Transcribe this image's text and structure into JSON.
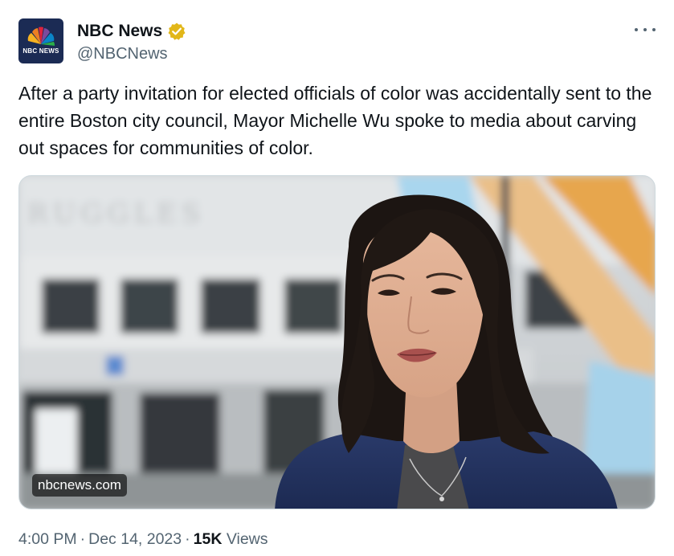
{
  "author": {
    "display_name": "NBC News",
    "handle": "@NBCNews",
    "avatar_text": "NBC NEWS",
    "verified_badge": "gold-verified-badge-icon"
  },
  "tweet": {
    "text": "After a party invitation for elected officials of color was accidentally sent to the entire Boston city council, Mayor Michelle Wu spoke to media about carving out spaces for communities of color.",
    "media_source_label": "nbcnews.com",
    "image_sign_text": "RUGGLES"
  },
  "meta": {
    "time": "4:00 PM",
    "separator": "·",
    "date": "Dec 14, 2023",
    "views_count": "15K",
    "views_label": "Views"
  },
  "icons": {
    "more": "more-options-icon",
    "logo": "nbc-peacock-icon"
  },
  "colors": {
    "text_primary": "#0f1419",
    "text_secondary": "#536471",
    "verified_gold": "#e2b719",
    "avatar_bg": "#1b2b54"
  }
}
